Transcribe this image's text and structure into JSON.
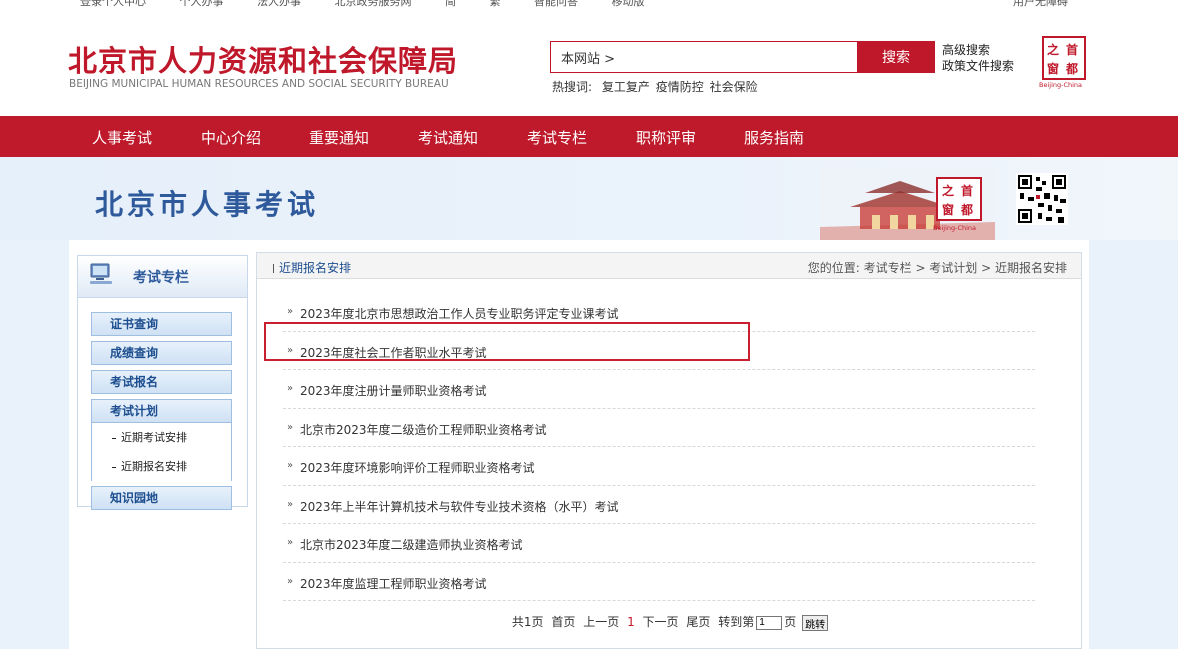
{
  "top_strip": {
    "items": [
      "登录个人中心",
      "个人办事",
      "法人办事",
      "北京政务服务网",
      "简",
      "繁",
      "智能问答",
      "移动版"
    ],
    "right": "用户无障碍"
  },
  "header": {
    "title_cn": "北京市人力资源和社会保障局",
    "title_en": "BEIJING MUNICIPAL HUMAN RESOURCES AND SOCIAL SECURITY BUREAU",
    "search_value": "本网站 >",
    "search_button": "搜索",
    "advanced_search": "高级搜索",
    "policy_search": "政策文件搜索",
    "hot_label": "热搜词:",
    "hot_words": [
      "复工复产",
      "疫情防控",
      "社会保险"
    ],
    "seal_chars": [
      "之",
      "首",
      "窗",
      "都"
    ],
    "seal_caption": "Beijing-China"
  },
  "nav": {
    "items": [
      "人事考试",
      "中心介绍",
      "重要通知",
      "考试通知",
      "考试专栏",
      "职称评审",
      "服务指南"
    ]
  },
  "banner": {
    "title": "北京市人事考试"
  },
  "sidebar": {
    "title": "考试专栏",
    "buttons": [
      "证书查询",
      "成绩查询",
      "考试报名",
      "考试计划"
    ],
    "sub_items": [
      "近期考试安排",
      "近期报名安排"
    ],
    "last_button": "知识园地"
  },
  "main": {
    "section_title": "近期报名安排",
    "breadcrumb": "您的位置: 考试专栏 > 考试计划 > 近期报名安排",
    "bullet": "»",
    "items": [
      "2023年度北京市思想政治工作人员专业职务评定专业课考试",
      "2023年度社会工作者职业水平考试",
      "2023年度注册计量师职业资格考试",
      "北京市2023年度二级造价工程师职业资格考试",
      "2023年度环境影响评价工程师职业资格考试",
      "2023年上半年计算机技术与软件专业技术资格（水平）考试",
      "北京市2023年度二级建造师执业资格考试",
      "2023年度监理工程师职业资格考试"
    ],
    "pager": {
      "total": "共1页",
      "first": "首页",
      "prev": "上一页",
      "current": "1",
      "next": "下一页",
      "last": "尾页",
      "goto_prefix": "转到第",
      "goto_value": "1",
      "goto_suffix": "页",
      "jump": "跳转"
    }
  }
}
